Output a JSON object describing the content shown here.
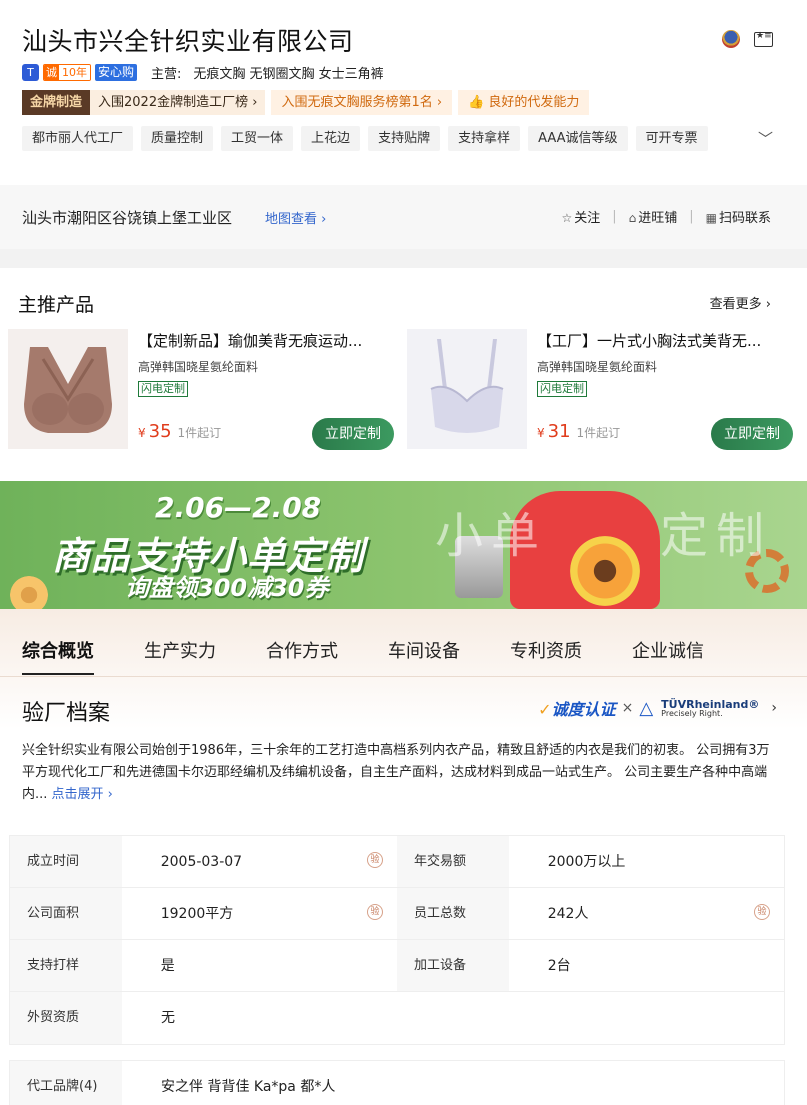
{
  "header": {
    "company_name": "汕头市兴全针织实业有限公司",
    "badge_t": "T",
    "cheng_a": "诚",
    "cheng_b": "10年",
    "anxin": "安心购",
    "main_biz_label": "主营:",
    "main_biz_text": "无痕文胸 无钢圈文胸 女士三角裤",
    "gold_label": "金牌制造",
    "gold_rank": "入围2022金牌制造工厂榜 ›",
    "rank_service": "入围无痕文胸服务榜第1名 ›",
    "good_ability": "良好的代发能力",
    "chips": [
      "都市丽人代工厂",
      "质量控制",
      "工贸一体",
      "上花边",
      "支持贴牌",
      "支持拿样",
      "AAA诚信等级",
      "可开专票"
    ],
    "expand_icon": "chevron-down-icon"
  },
  "address": {
    "text": "汕头市潮阳区谷饶镇上堡工业区",
    "map_link": "地图查看 ›",
    "follow": "关注",
    "wangpu": "进旺铺",
    "scan": "扫码联系"
  },
  "products": {
    "title": "主推产品",
    "more": "查看更多 ›",
    "items": [
      {
        "title": "【定制新品】瑜伽美背无痕运动...",
        "subtitle": "高弹韩国晓星氨纶面料",
        "badge": "闪电定制",
        "currency": "¥",
        "price": "35",
        "min_order": "1件起订",
        "button": "立即定制",
        "color": "#a57a6c"
      },
      {
        "title": "【工厂】一片式小胸法式美背无...",
        "subtitle": "高弹韩国晓星氨纶面料",
        "badge": "闪电定制",
        "currency": "¥",
        "price": "31",
        "min_order": "1件起订",
        "button": "立即定制",
        "color": "#d8d8ea"
      }
    ]
  },
  "banner": {
    "date": "2.06—2.08",
    "main": "商品支持小单定制",
    "sub": "询盘领300减30券",
    "deco1": "小单",
    "deco2": "定制"
  },
  "tabs": [
    "综合概览",
    "生产实力",
    "合作方式",
    "车间设备",
    "专利资质",
    "企业诚信"
  ],
  "profile": {
    "title": "验厂档案",
    "cert1": "诚度认证",
    "cert_x": "×",
    "tuv_1": "TÜVRheinland®",
    "tuv_2": "Precisely Right.",
    "description": "兴全针织实业有限公司始创于1986年，三十余年的工艺打造中高档系列内衣产品，精致且舒适的内衣是我们的初衷。 公司拥有3万平方现代化工厂和先进德国卡尔迈耶经编机及纬编机设备，自主生产面料，达成材料到成品一站式生产。 公司主要生产各种中高端内...",
    "expand": "点击展开 ›",
    "verify_mark": "验",
    "rows": [
      [
        {
          "label": "成立时间",
          "value": "2005-03-07",
          "verified": true
        },
        {
          "label": "年交易额",
          "value": "2000万以上",
          "verified": false
        }
      ],
      [
        {
          "label": "公司面积",
          "value": "19200平方",
          "verified": true
        },
        {
          "label": "员工总数",
          "value": "242人",
          "verified": true
        }
      ],
      [
        {
          "label": "支持打样",
          "value": "是",
          "verified": false
        },
        {
          "label": "加工设备",
          "value": "2台",
          "verified": false
        }
      ],
      [
        {
          "label": "外贸资质",
          "value": "无",
          "verified": false
        }
      ]
    ],
    "brand_label": "代工品牌(4)",
    "brand_value": "安之伴 背背佳 Ka*pa 都*人"
  }
}
